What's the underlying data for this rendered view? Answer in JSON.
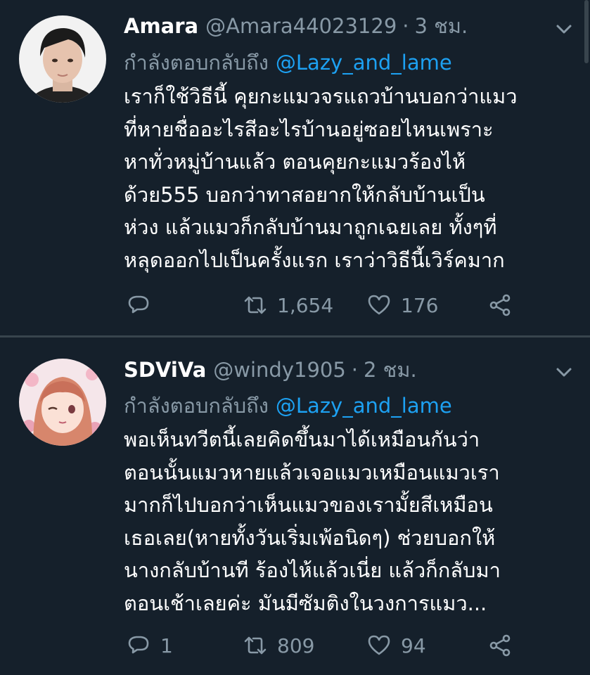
{
  "tweets": [
    {
      "name": "Amara",
      "handle": "@Amara44023129",
      "separator": "·",
      "time": "3 ชม.",
      "reply_prefix": "กำลังตอบกลับถึง",
      "mention": "@Lazy_and_lame",
      "lines": [
        "เราก็ใช้วิธีนี้ คุยกะแมวจรแถวบ้านบอกว่าแมว",
        "ที่หายชื่ออะไรสีอะไรบ้านอยู่ซอยไหนเพราะ",
        "หาทั่วหมู่บ้านแล้ว ตอนคุยกะแมวร้องไห้",
        "ด้วย555 บอกว่าทาสอยากให้กลับบ้านเป็น",
        "ห่วง แล้วแมวก็กลับบ้านมาถูกเฉยเลย ทั้งๆที่",
        "หลุดออกไปเป็นครั้งแรก  เราว่าวิธีนี้เวิร์คมาก"
      ],
      "reply_count": "",
      "retweet_count": "1,654",
      "like_count": "176"
    },
    {
      "name": "SDViVa",
      "handle": "@windy1905",
      "separator": "·",
      "time": "2 ชม.",
      "reply_prefix": "กำลังตอบกลับถึง",
      "mention": "@Lazy_and_lame",
      "lines": [
        "พอเห็นทวีตนี้เลยคิดขึ้นมาได้เหมือนกันว่า",
        "ตอนนั้นแมวหายแล้วเจอแมวเหมือนแมวเรา",
        "มากก็ไปบอกว่าเห็นแมวของเรามั้ยสีเหมือน",
        "เธอเลย(หายทั้งวันเริ่มเพ้อนิดๆ) ช่วยบอกให้",
        "นางกลับบ้านที ร้องไห้แล้วเนี่ย แล้วก็กลับมา",
        "ตอนเช้าเลยค่ะ มันมีซัมติงในวงการแมว..."
      ],
      "reply_count": "1",
      "retweet_count": "809",
      "like_count": "94"
    }
  ],
  "icons": {
    "reply": "reply-icon",
    "retweet": "retweet-icon",
    "like": "heart-icon",
    "share": "share-icon",
    "more": "chevron-down-icon"
  },
  "colors": {
    "background": "#15202b",
    "secondary_text": "#8899a6",
    "link": "#1da1f2",
    "divider": "#38444d"
  }
}
